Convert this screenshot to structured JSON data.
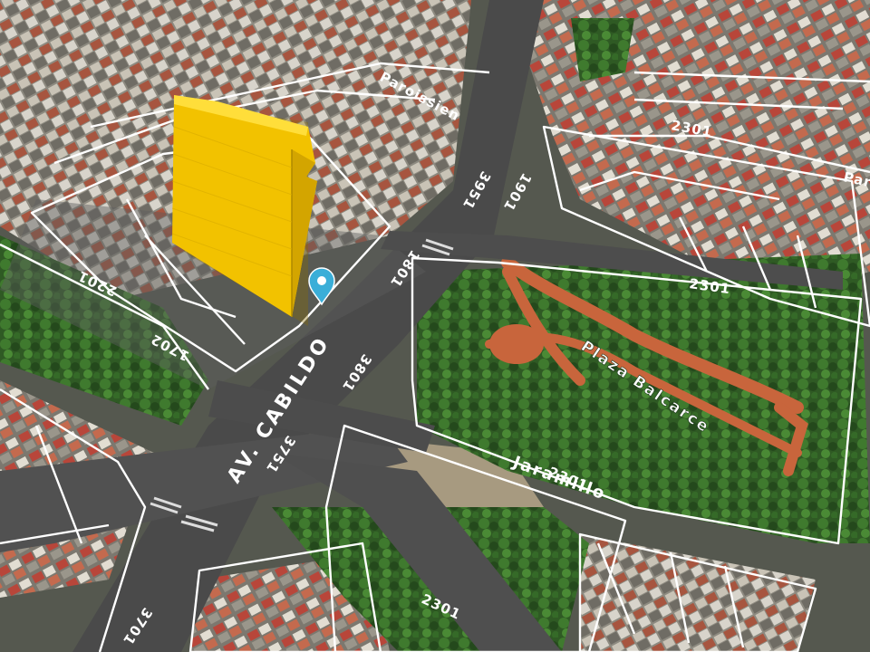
{
  "map": {
    "view": "3d-satellite",
    "street_labels": {
      "main_avenue": "AV. CABILDO",
      "park_name": "Plaza Balcarce",
      "jaramillo": "Jaramillo",
      "paroissien": "Paroissien",
      "pare_partial": "Pare"
    },
    "address_numbers": {
      "n3701": "3701",
      "n3751": "3751",
      "n3801": "3801",
      "n1801": "1801",
      "n3951": "3951",
      "n1901": "1901",
      "n2201": "2201",
      "n2301_right": "2301",
      "n2301_jaramillo": "2301",
      "n2301_bottom": "2301",
      "n2301_top": "2301",
      "n1702": "1702"
    },
    "highlighted_building_color": "#f2c200",
    "location_pin_color": "#3aaed8",
    "parcel_outline_color": "#ffffff"
  }
}
